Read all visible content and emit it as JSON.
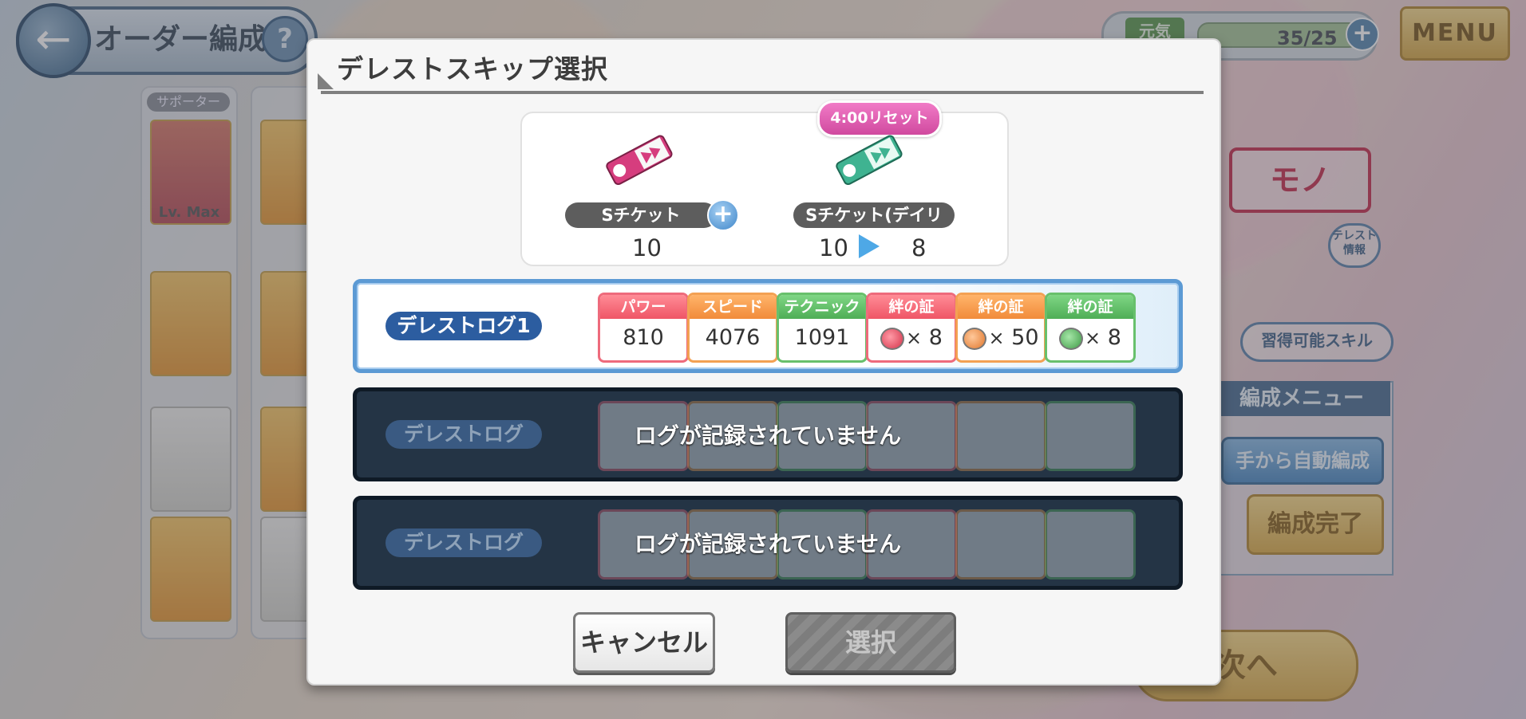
{
  "background": {
    "title": "オーダー編成",
    "menu_label": "MENU",
    "stamina_tag": "元気",
    "stamina_value": "35/25",
    "supporter_label": "サポーター",
    "card_level": "Lv. Max",
    "team_menu_label": "編成メニュー",
    "auto_team_label": "手から自動編成",
    "team_done_label": "編成完了",
    "next_label": "次へ",
    "skills_label": "習得可能スキル",
    "info_label": "テレスト情報"
  },
  "modal": {
    "title": "デレストスキップ選択",
    "ticket": {
      "label": "Sチケット",
      "count": "10",
      "plus_icon": "plus-icon"
    },
    "daily_ticket": {
      "label": "Sチケット(デイリー)",
      "count_before": "10",
      "count_after": "8",
      "reset_badge": "4:00リセット"
    },
    "logs": [
      {
        "label": "デレストログ1",
        "stats": [
          {
            "name": "パワー",
            "value": "810"
          },
          {
            "name": "スピード",
            "value": "4076"
          },
          {
            "name": "テクニック",
            "value": "1091"
          },
          {
            "name": "絆の証",
            "value": "8",
            "prefix": "×"
          },
          {
            "name": "絆の証",
            "value": "50",
            "prefix": "×"
          },
          {
            "name": "絆の証",
            "value": "8",
            "prefix": "×"
          }
        ]
      },
      {
        "label": "デレストログ",
        "message": "ログが記録されていません"
      },
      {
        "label": "デレストログ",
        "message": "ログが記録されていません"
      }
    ],
    "cancel_label": "キャンセル",
    "select_label": "選択"
  }
}
